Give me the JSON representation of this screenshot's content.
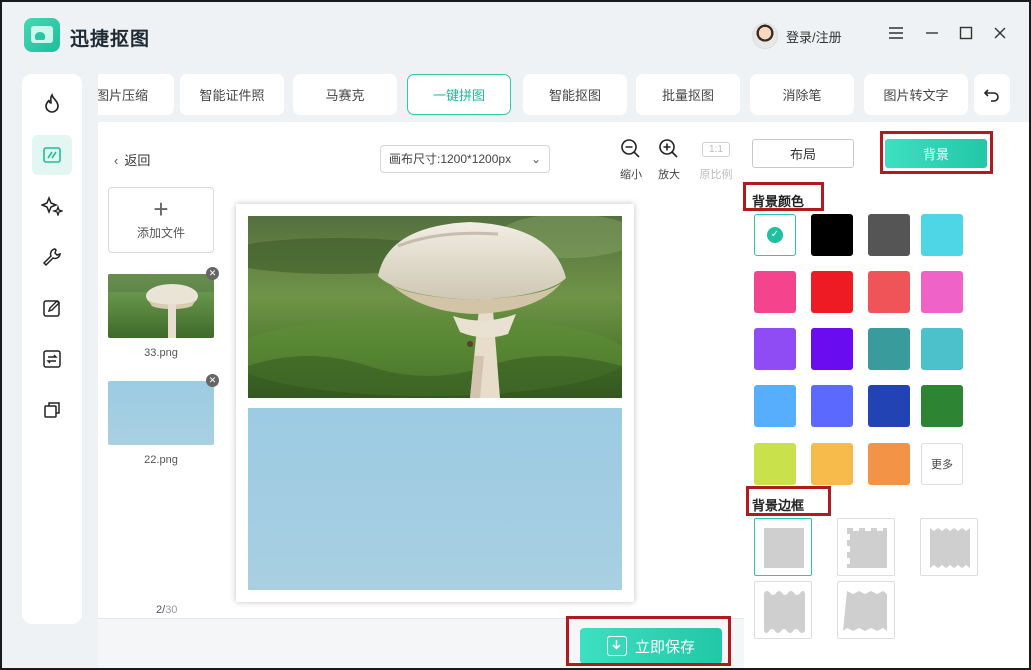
{
  "app": {
    "title": "迅捷抠图",
    "login": "登录/注册"
  },
  "nav": {
    "items": [
      {
        "name": "fire-icon"
      },
      {
        "name": "crop-icon",
        "active": true
      },
      {
        "name": "sparkle-icon"
      },
      {
        "name": "wrench-icon"
      },
      {
        "name": "edit-icon"
      },
      {
        "name": "convert-icon"
      },
      {
        "name": "layers-icon"
      }
    ]
  },
  "tabs": [
    "图片压缩",
    "智能证件照",
    "马赛克",
    "一键拼图",
    "智能抠图",
    "批量抠图",
    "消除笔",
    "图片转文字"
  ],
  "active_tab": "一键拼图",
  "toolbar": {
    "back": "返回",
    "canvas_size": "画布尺寸:1200*1200px",
    "zoom_out": "缩小",
    "zoom_in": "放大",
    "ratio_box": "1:1",
    "original_ratio": "原比例"
  },
  "files": {
    "add_label": "添加文件",
    "items": [
      {
        "name": "33.png"
      },
      {
        "name": "22.png"
      }
    ],
    "page_current": "2/",
    "page_total": "30"
  },
  "save": {
    "label": "立即保存"
  },
  "panel": {
    "layout_tab": "布局",
    "background_tab": "背景",
    "bg_color_title": "背景颜色",
    "bg_border_title": "背景边框",
    "more_label": "更多",
    "swatches": [
      "#ffffff",
      "#000000",
      "#555555",
      "#4fd6e6",
      "#f4448d",
      "#ef1b24",
      "#ef5458",
      "#ef62c8",
      "#8f4cf5",
      "#6a0cf0",
      "#3a9b9d",
      "#4cc0cb",
      "#56aefc",
      "#5b69ff",
      "#2243b3",
      "#2d8433",
      "#c9e14a",
      "#f7bb4c",
      "#f39345"
    ],
    "border_styles": [
      "plain",
      "notched",
      "zigzag",
      "wavy",
      "stamp"
    ]
  }
}
